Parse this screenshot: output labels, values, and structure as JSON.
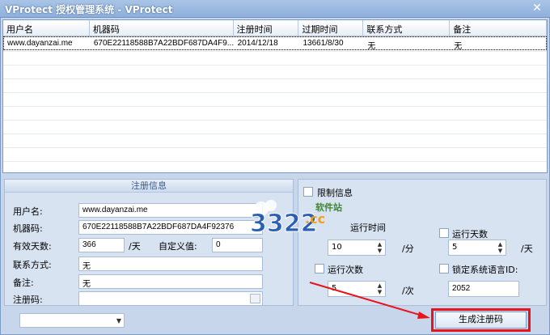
{
  "window": {
    "title": "VProtect 授权管理系统 - VProtect",
    "close_glyph": "✕"
  },
  "table": {
    "headers": [
      "用户名",
      "机器码",
      "注册时间",
      "过期时间",
      "联系方式",
      "备注"
    ],
    "rows": [
      [
        "www.dayanzai.me",
        "670E22118588B7A22BDF687DA4F9...",
        "2014/12/18",
        "13661/8/30",
        "无",
        "无"
      ]
    ]
  },
  "reg_info": {
    "header": "注册信息",
    "username_label": "用户名:",
    "username_value": "www.dayanzai.me",
    "machine_label": "机器码:",
    "machine_value": "670E22118588B7A22BDF687DA4F92376",
    "valid_days_label": "有效天数:",
    "valid_days_value": "366",
    "valid_days_unit": "/天",
    "custom_label": "自定义值:",
    "custom_value": "0",
    "contact_label": "联系方式:",
    "contact_value": "无",
    "note_label": "备注:",
    "note_value": "无",
    "regcode_label": "注册码:",
    "regcode_value": ""
  },
  "limit_info": {
    "header": "限制信息",
    "run_time_label": "运行时间",
    "run_time_value": "10",
    "run_time_unit": "/分",
    "run_days_label": "运行天数",
    "run_days_value": "5",
    "run_days_unit": "/天",
    "run_count_label": "运行次数",
    "run_count_value": "5",
    "run_count_unit": "/次",
    "lang_label": "锁定系统语言ID:",
    "lang_value": "2052"
  },
  "bottom": {
    "combo_value": "",
    "generate_label": "生成注册码"
  },
  "watermark": {
    "text": "软件站",
    "brand": "3322",
    "suffix": ".cc"
  },
  "colors": {
    "accent": "#e8141b",
    "window": "#c7d6ea"
  }
}
